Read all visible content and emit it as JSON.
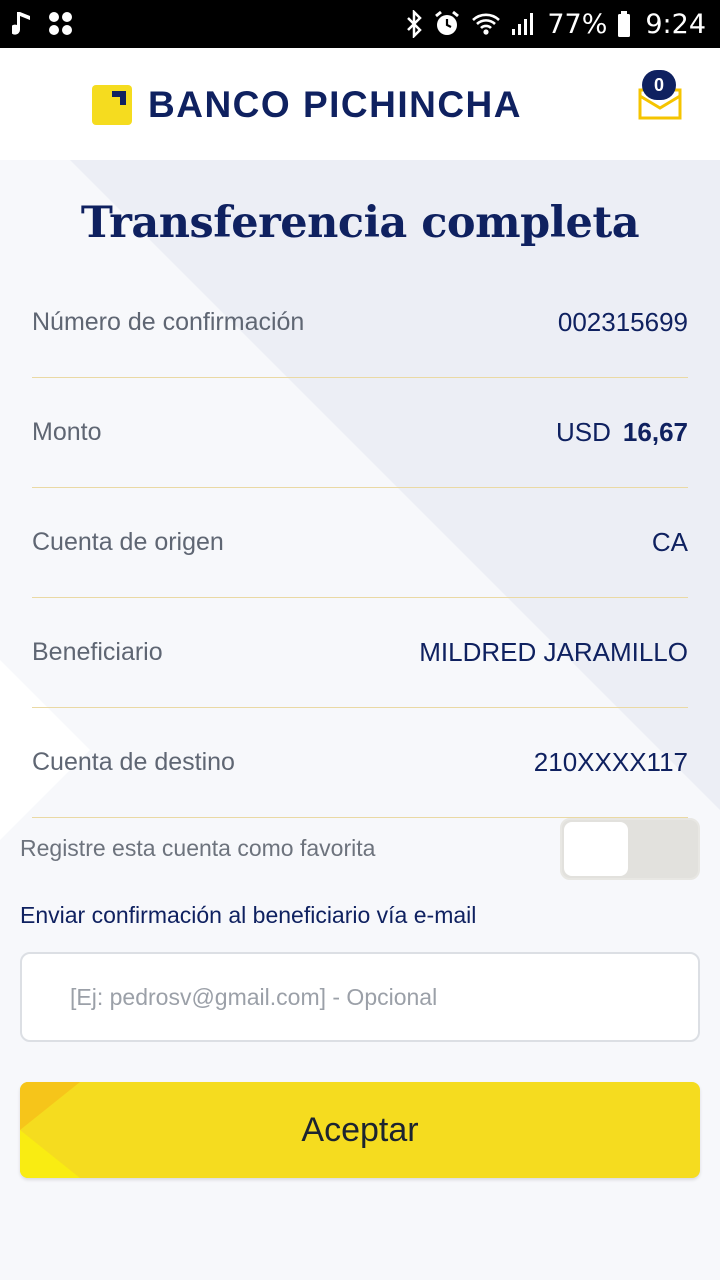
{
  "status_bar": {
    "battery_percent": "77%",
    "time": "9:24"
  },
  "header": {
    "brand_name": "BANCO PICHINCHA",
    "mail_badge_count": "0"
  },
  "page": {
    "title": "Transferencia completa"
  },
  "details": [
    {
      "label": "Número de confirmación",
      "value": "002315699"
    },
    {
      "label": "Monto",
      "currency": "USD",
      "amount": "16,67"
    },
    {
      "label": "Cuenta de origen",
      "value": "CA"
    },
    {
      "label": "Beneficiario",
      "value": "MILDRED JARAMILLO"
    },
    {
      "label": "Cuenta de destino",
      "value": "210XXXX117"
    }
  ],
  "favorite": {
    "label": "Registre esta cuenta como favorita",
    "enabled": false
  },
  "email": {
    "label": "Enviar confirmación al beneficiario vía e-mail",
    "placeholder": "[Ej: pedrosv@gmail.com] - Opcional",
    "value": ""
  },
  "actions": {
    "accept_label": "Aceptar"
  },
  "colors": {
    "brand_navy": "#0f2160",
    "brand_yellow": "#f5dc1f",
    "divider": "#ead9a4"
  }
}
